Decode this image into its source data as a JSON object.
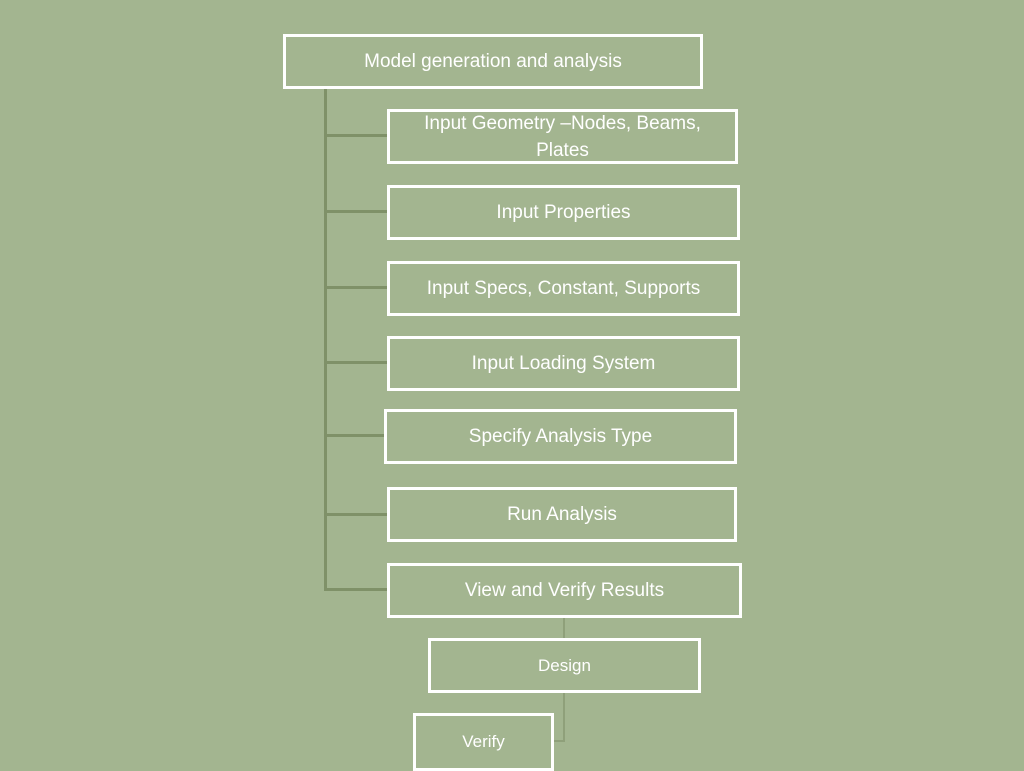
{
  "diagram": {
    "root": {
      "label": "Model generation and analysis"
    },
    "steps": [
      {
        "label": "Input Geometry –Nodes, Beams, Plates"
      },
      {
        "label": "Input Properties"
      },
      {
        "label": "Input Specs, Constant, Supports"
      },
      {
        "label": "Input Loading System"
      },
      {
        "label": "Specify Analysis Type"
      },
      {
        "label": "Run Analysis"
      },
      {
        "label": "View and Verify Results"
      }
    ],
    "design": {
      "label": "Design"
    },
    "verify": {
      "label": "Verify"
    },
    "colors": {
      "background": "#a3b590",
      "box_border": "#ffffff",
      "text": "#ffffff",
      "connector": "#7f9168"
    }
  }
}
